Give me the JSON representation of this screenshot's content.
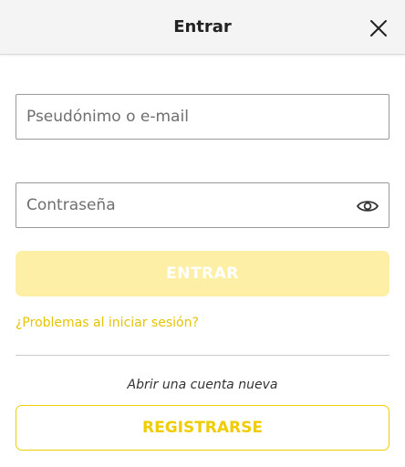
{
  "header": {
    "title": "Entrar",
    "close_icon": "close-icon"
  },
  "form": {
    "username": {
      "placeholder": "Pseudónimo o e-mail",
      "value": ""
    },
    "password": {
      "placeholder": "Contraseña",
      "value": "",
      "toggle_icon": "eye-icon"
    },
    "submit_label": "ENTRAR",
    "trouble_link": "¿Problemas al iniciar sesión?"
  },
  "register": {
    "prompt": "Abrir una cuenta nueva",
    "button_label": "REGISTRARSE"
  },
  "colors": {
    "header_bg": "#f4f4f4",
    "accent": "#f0cc00",
    "submit_disabled_bg": "#fdf0a6",
    "link": "#e7c300"
  }
}
